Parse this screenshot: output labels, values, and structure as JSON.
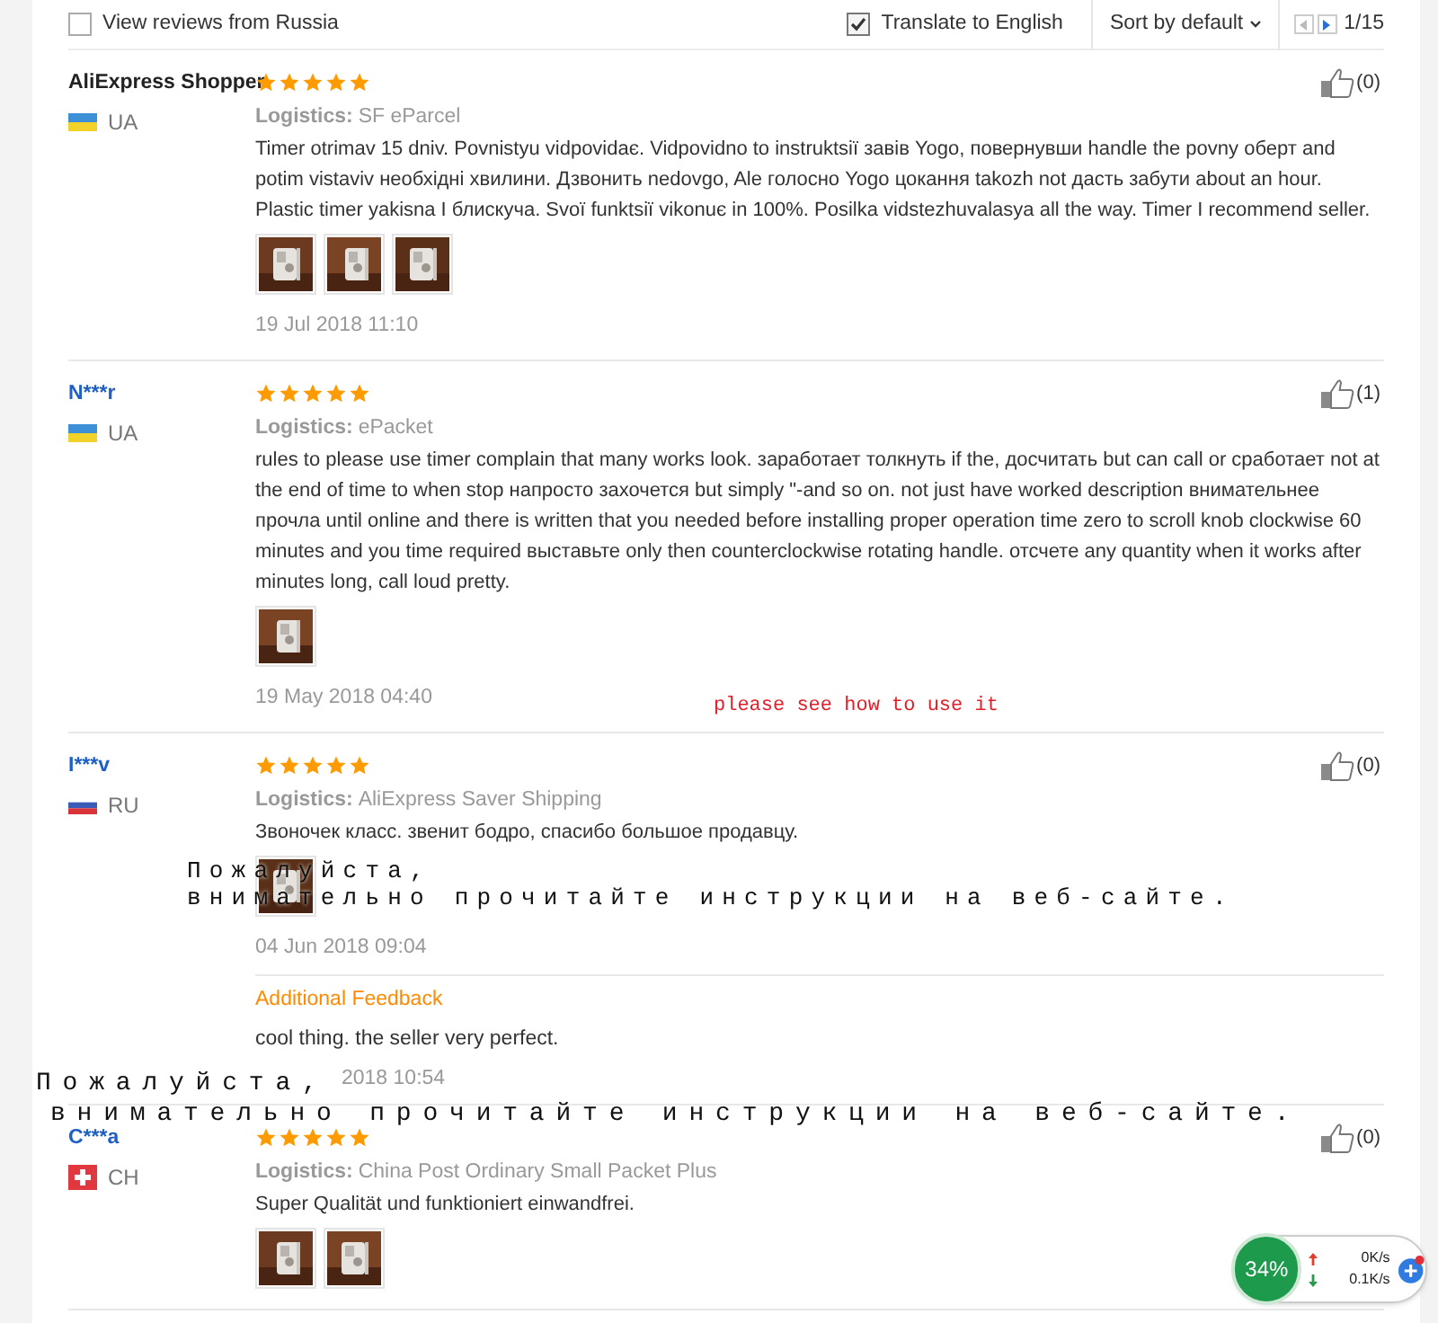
{
  "toolbar": {
    "russia_filter": {
      "label": "View reviews from Russia",
      "checked": false
    },
    "translate": {
      "label": "Translate to English",
      "checked": true
    },
    "sort": {
      "label": "Sort by default"
    },
    "pager": {
      "prev_disabled": true,
      "next_disabled": false,
      "page": "1/15"
    }
  },
  "reviews": [
    {
      "name": "AliExpress Shopper",
      "is_link": false,
      "country": "UA",
      "flag": {
        "kind": "ukraine"
      },
      "stars": 5,
      "likes": "(0)",
      "logistics_label": "Logistics:",
      "logistics": "SF eParcel",
      "text": "Timer otrimav 15 dniv. Povnistyu vidpovidaє. Vidpovidno to instruktsiї завів Yogo, повернувши handle the povny оберт and potim vistaviv необхідні хвилини. Дзвонить nedovgo, Ale голосно Yogo цокання takozh not дасть забути about an hour. Plastic timer yakisna I блискуча. Svoї funktsiї vikonuє in 100%. Posilka vidstezhuvalasya all the way. Timer I recommend seller.",
      "photos": [
        {
          "kind": "picture"
        },
        {
          "kind": "picture"
        },
        {
          "kind": "picture"
        }
      ],
      "date": "19 Jul 2018 11:10"
    },
    {
      "name": "N***r",
      "is_link": true,
      "country": "UA",
      "flag": {
        "kind": "ukraine"
      },
      "stars": 5,
      "likes": "(1)",
      "logistics_label": "Logistics:",
      "logistics": "ePacket",
      "text": "rules to please use timer complain that many works look. заработает толкнуть if the, досчитать but can call or сработает not at the end of time to when stop напросто захочется but simply \"-and so on. not just have worked description внимательнее прочла until online and there is written that you needed before installing proper operation time zero to scroll knob clockwise 60 minutes and you time required выставьте only then counterclockwise rotating handle. отсчете any quantity when it works after minutes long, call loud pretty.",
      "photos": [
        {
          "kind": "picture"
        }
      ],
      "date": "19 May 2018 04:40"
    },
    {
      "name": "I***v",
      "is_link": true,
      "country": "RU",
      "flag": {
        "kind": "russia"
      },
      "stars": 5,
      "likes": "(0)",
      "logistics_label": "Logistics:",
      "logistics": "AliExpress Saver Shipping",
      "text": "Звоночек класс. звенит бодро, спасибо большое продавцу.",
      "photos": [
        {
          "kind": "picture"
        }
      ],
      "date": "04 Jun 2018 09:04",
      "additional": {
        "title": "Additional Feedback",
        "text": "cool thing. the seller very perfect.",
        "date": "2018 10:54"
      }
    },
    {
      "name": "C***a",
      "is_link": true,
      "country": "CH",
      "flag": {
        "kind": "switzerland"
      },
      "stars": 5,
      "likes": "(0)",
      "logistics_label": "Logistics:",
      "logistics": "China Post Ordinary Small Packet Plus",
      "text": "Super Qualität und funktioniert einwandfrei.",
      "photos": [
        {
          "kind": "picture"
        },
        {
          "kind": "picture"
        }
      ]
    }
  ],
  "overlays": [
    {
      "kind": "note",
      "text": "please see how to use it"
    },
    {
      "kind": "caption",
      "lines": [
        "Пожалуйста,",
        "внимательно прочитайте инструкции на веб-сайте."
      ]
    },
    {
      "kind": "caption_large",
      "lines": [
        "Пожалуйста,",
        "внимательно прочитайте инструкции на веб-сайте."
      ]
    }
  ],
  "net_widget": {
    "percent": "34%",
    "upload": "0K/s",
    "download": "0.1K/s"
  }
}
